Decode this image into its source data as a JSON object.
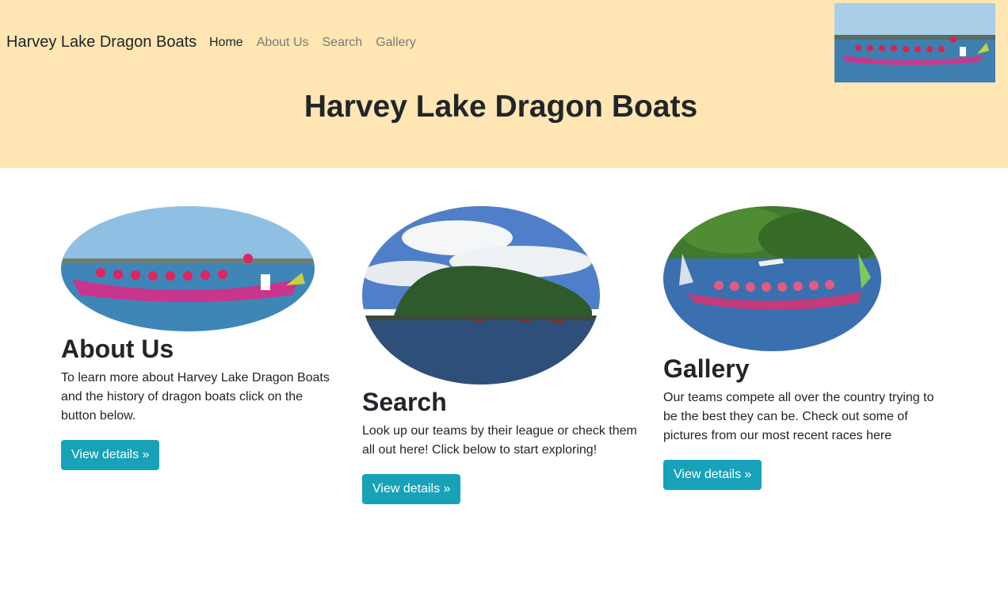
{
  "navbar": {
    "brand": "Harvey Lake Dragon Boats",
    "links": [
      {
        "label": "Home",
        "active": true
      },
      {
        "label": "About Us",
        "active": false
      },
      {
        "label": "Search",
        "active": false
      },
      {
        "label": "Gallery",
        "active": false
      }
    ]
  },
  "header": {
    "title": "Harvey Lake Dragon Boats",
    "background_color": "#ffe6b3"
  },
  "cards": [
    {
      "title": "About Us",
      "text": "To learn more about Harvey Lake Dragon Boats and the history of dragon boats click on the button below.",
      "button": "View details »"
    },
    {
      "title": "Search",
      "text": "Look up our teams by their league or check them all out here! Click below to start exploring!",
      "button": "View details »"
    },
    {
      "title": "Gallery",
      "text": "Our teams compete all over the country trying to be the best they can be. Check out some of pictures from our most recent races here",
      "button": "View details »"
    }
  ],
  "colors": {
    "accent": "#17a2b8",
    "nav_inactive": "#7a7a7a"
  }
}
